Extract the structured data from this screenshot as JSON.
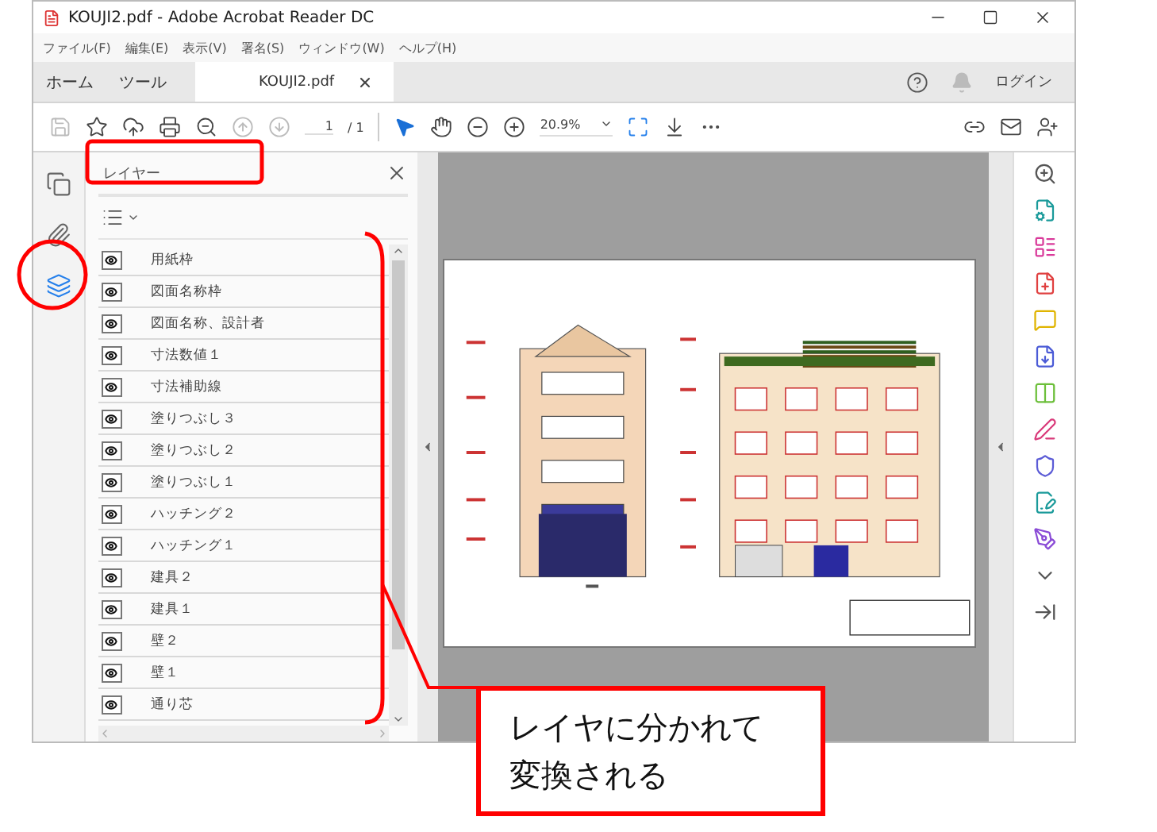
{
  "window": {
    "title": "KOUJI2.pdf - Adobe Acrobat Reader DC"
  },
  "menu": [
    "ファイル(F)",
    "編集(E)",
    "表示(V)",
    "署名(S)",
    "ウィンドウ(W)",
    "ヘルプ(H)"
  ],
  "tabs": [
    {
      "label": "ホーム",
      "selected": false,
      "kind": "nav"
    },
    {
      "label": "ツール",
      "selected": false,
      "kind": "nav"
    },
    {
      "label": "KOUJI2.pdf",
      "selected": true,
      "kind": "document"
    }
  ],
  "login": "ログイン",
  "toolbar": {
    "page": "1",
    "page_total": "/ 1",
    "zoom": "20.9%"
  },
  "sidebar": {
    "items": [
      {
        "kind": "pages",
        "selected": false
      },
      {
        "kind": "attachments",
        "selected": false
      },
      {
        "kind": "layers",
        "selected": true
      }
    ]
  },
  "panel": {
    "title": "レイヤー",
    "layers": [
      {
        "name": "用紙枠",
        "visible": true
      },
      {
        "name": "図面名称枠",
        "visible": true
      },
      {
        "name": "図面名称、設計者",
        "visible": true
      },
      {
        "name": "寸法数値１",
        "visible": true
      },
      {
        "name": "寸法補助線",
        "visible": true
      },
      {
        "name": "塗りつぶし３",
        "visible": true
      },
      {
        "name": "塗りつぶし２",
        "visible": true
      },
      {
        "name": "塗りつぶし１",
        "visible": true
      },
      {
        "name": "ハッチング２",
        "visible": true
      },
      {
        "name": "ハッチング１",
        "visible": true
      },
      {
        "name": "建具２",
        "visible": true
      },
      {
        "name": "建具１",
        "visible": true
      },
      {
        "name": "壁２",
        "visible": true
      },
      {
        "name": "壁１",
        "visible": true
      },
      {
        "name": "通り芯",
        "visible": true
      }
    ]
  },
  "callout": {
    "lines": [
      "レイヤに分かれて",
      "変換される"
    ]
  }
}
